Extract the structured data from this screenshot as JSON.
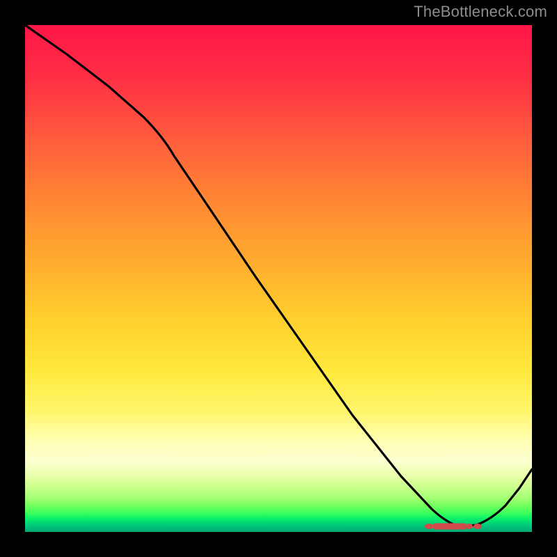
{
  "attribution": "TheBottleneck.com",
  "chart_data": {
    "type": "line",
    "title": "",
    "xlabel": "",
    "ylabel": "",
    "xlim": [
      0,
      100
    ],
    "ylim": [
      0,
      100
    ],
    "series": [
      {
        "name": "curve",
        "x": [
          0,
          6,
          12,
          18,
          24,
          28,
          32,
          40,
          48,
          56,
          64,
          72,
          78,
          82,
          85,
          88,
          90,
          93,
          96,
          100
        ],
        "y": [
          100,
          95,
          89,
          83,
          77,
          72,
          66,
          55,
          44,
          33,
          22,
          12,
          5,
          2,
          1,
          1,
          2,
          4,
          8,
          14
        ]
      }
    ],
    "annotations": [
      {
        "name": "bottleneck-region",
        "x_start": 80,
        "x_end": 90,
        "y": 1
      }
    ]
  },
  "colors": {
    "background": "#000000",
    "gradient_top": "#ff1648",
    "gradient_mid": "#ffe83c",
    "gradient_bottom": "#00bf7a",
    "curve": "#000000",
    "marker": "#d24a4a",
    "attribution_text": "#8d8d8d"
  }
}
